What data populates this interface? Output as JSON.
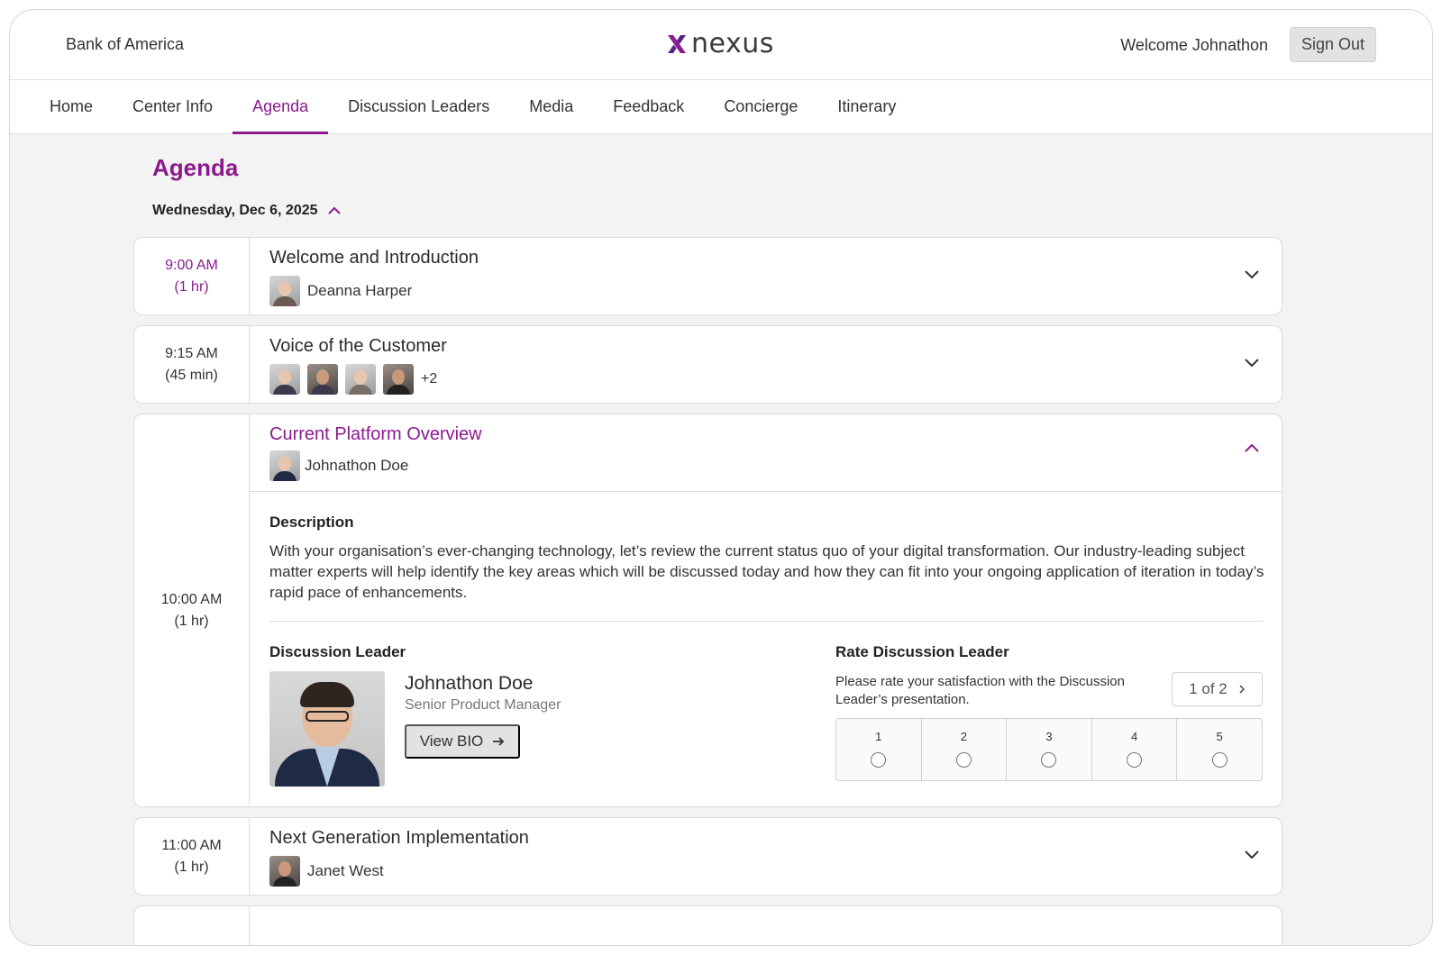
{
  "header": {
    "bank_name": "Bank of America",
    "logo_text": "nexus",
    "welcome": "Welcome Johnathon",
    "sign_out": "Sign Out"
  },
  "nav": {
    "items": [
      {
        "label": "Home"
      },
      {
        "label": "Center Info"
      },
      {
        "label": "Agenda",
        "active": true
      },
      {
        "label": "Discussion Leaders"
      },
      {
        "label": "Media"
      },
      {
        "label": "Feedback"
      },
      {
        "label": "Concierge"
      },
      {
        "label": "Itinerary"
      }
    ]
  },
  "agenda": {
    "title": "Agenda",
    "date": "Wednesday, Dec 6, 2025",
    "sessions": [
      {
        "time": "9:00 AM",
        "duration": "(1 hr)",
        "title": "Welcome and Introduction",
        "presenter": "Deanna Harper",
        "expanded": false,
        "current_time": true
      },
      {
        "time": "9:15 AM",
        "duration": "(45 min)",
        "title": "Voice of the Customer",
        "extra_presenters": "+2",
        "expanded": false
      },
      {
        "time": "10:00 AM",
        "duration": "(1 hr)",
        "title": "Current Platform Overview",
        "presenter": "Johnathon Doe",
        "expanded": true,
        "description_label": "Description",
        "description": "With your organisation’s ever-changing technology, let’s review the current status quo of your digital transformation. Our industry-leading subject matter experts will help identify the key areas which will be discussed today and how they can fit into your ongoing application of iteration in today’s rapid pace of enhancements.",
        "leader_label": "Discussion Leader",
        "leader_name": "Johnathon Doe",
        "leader_role": "Senior Product Manager",
        "view_bio": "View BIO",
        "rate_label": "Rate Discussion Leader",
        "rate_description": "Please rate your satisfaction with the Discussion Leader’s presentation.",
        "pager": "1 of 2",
        "rating_options": [
          "1",
          "2",
          "3",
          "4",
          "5"
        ]
      },
      {
        "time": "11:00 AM",
        "duration": "(1 hr)",
        "title": "Next Generation Implementation",
        "presenter": "Janet West",
        "expanded": false
      }
    ]
  },
  "colors": {
    "accent": "#8b1a8f"
  }
}
